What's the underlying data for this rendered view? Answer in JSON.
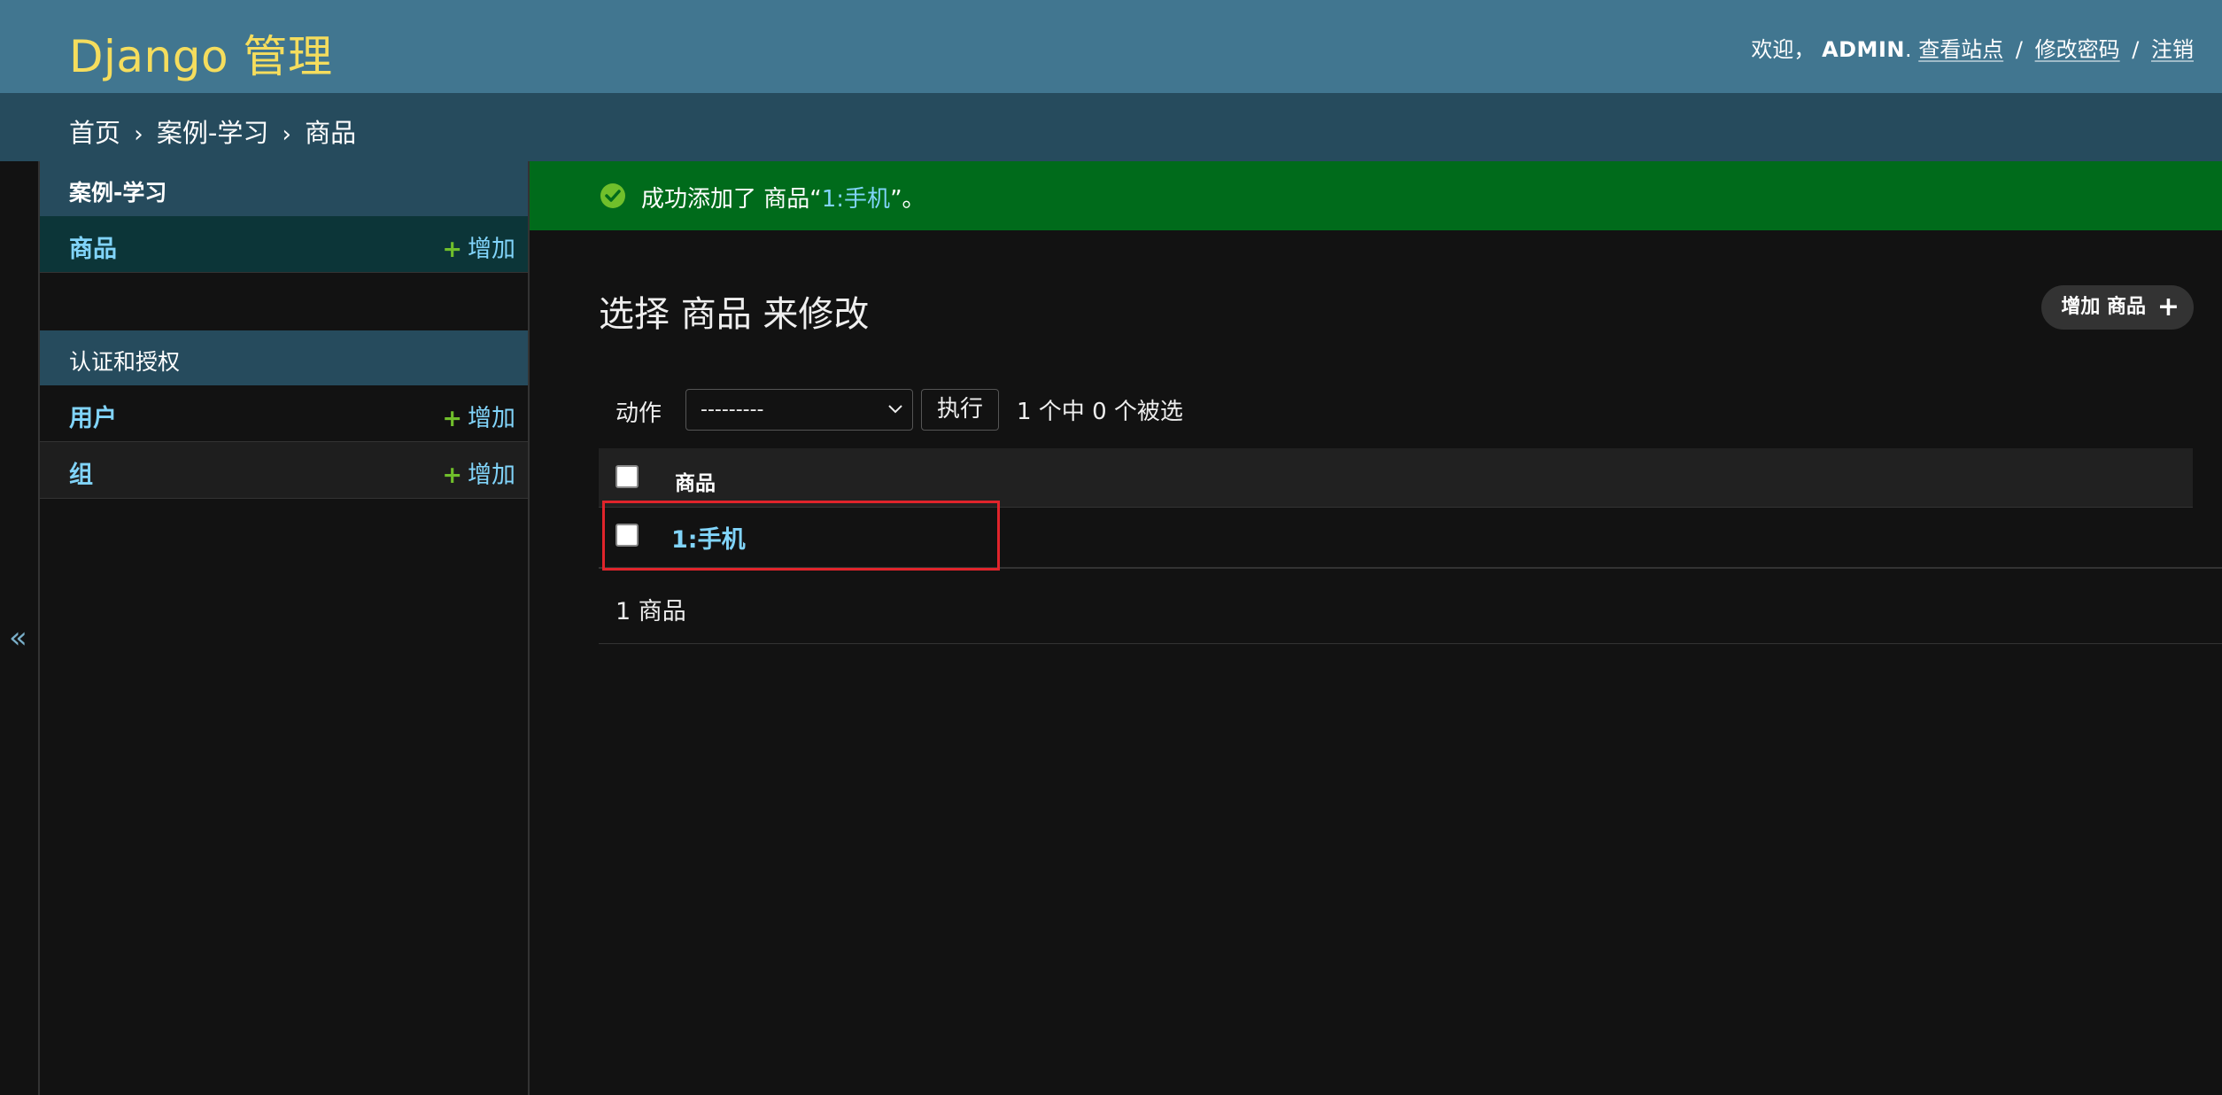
{
  "header": {
    "site_title": "Django 管理",
    "welcome": "欢迎，",
    "username": "ADMIN",
    "punct": ".",
    "links": [
      "查看站点",
      "修改密码",
      "注销"
    ],
    "separator": "/"
  },
  "breadcrumbs": {
    "items": [
      "首页",
      "案例-学习",
      "商品"
    ],
    "arrow": "›"
  },
  "sidebar": {
    "toggle_glyph": "«",
    "modules": [
      {
        "caption": "案例-学习",
        "models": [
          {
            "name": "商品",
            "add_label": "增加",
            "add_icon": "+"
          }
        ]
      },
      {
        "caption": "认证和授权",
        "models": [
          {
            "name": "用户",
            "add_label": "增加",
            "add_icon": "+"
          },
          {
            "name": "组",
            "add_label": "增加",
            "add_icon": "+"
          }
        ]
      }
    ]
  },
  "message": {
    "icon": "success-check-icon",
    "prefix": "成功添加了 商品“",
    "object": "1:手机",
    "suffix": "”。"
  },
  "main": {
    "title": "选择 商品 来修改",
    "add_button": "增加 商品",
    "add_button_icon": "+"
  },
  "actions": {
    "label": "动作",
    "selected_value": "---------",
    "go_label": "执行",
    "counter": "1 个中 0 个被选"
  },
  "table": {
    "columns": [
      "商品"
    ],
    "rows": [
      {
        "name": "1:手机"
      }
    ]
  },
  "paginator": {
    "text": "1 商品"
  },
  "colors": {
    "header_bg": "#417690",
    "brand_text": "#f5dd5d",
    "breadcrumbs_bg": "#264b5d",
    "success_bg": "#006b1b",
    "link": "#81d4fa",
    "add_plus": "#70bf2b",
    "highlight": "#e0242b"
  }
}
